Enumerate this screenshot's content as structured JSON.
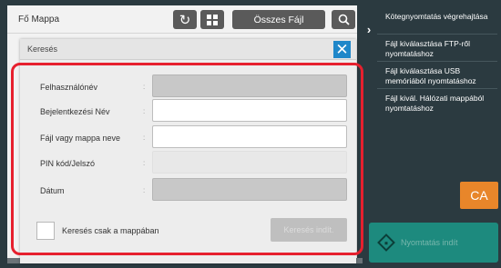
{
  "main": {
    "title": "Fő Mappa",
    "refresh_icon": "refresh-icon",
    "grid_icon": "grid-view-icon",
    "all_files_label": "Összes Fájl",
    "search_icon": "search-icon"
  },
  "right_menu": {
    "arrow": "›",
    "items": [
      {
        "label": "Kötegnyomtatás végrehajtása"
      },
      {
        "label": "Fájl kiválasztása FTP-ről nyomtatáshoz"
      },
      {
        "label": "Fájl kiválasztása USB memóriából nyomtatáshoz"
      },
      {
        "label": "Fájl kivál. Hálózati mappából nyomtatáshoz"
      }
    ],
    "ca_label": "CA",
    "print_label": "Nyomtatás indít"
  },
  "dialog": {
    "title": "Keresés",
    "close_icon": "close-icon",
    "fields": [
      {
        "label": "Felhasználónév",
        "colon": ":",
        "value": "",
        "state": "disabled"
      },
      {
        "label": "Bejelentkezési Név",
        "colon": ":",
        "value": "",
        "state": "enabled"
      },
      {
        "label": "Fájl vagy mappa neve",
        "colon": ":",
        "value": "",
        "state": "enabled"
      },
      {
        "label": "PIN kód/Jelszó",
        "colon": ":",
        "value": "",
        "state": "flat"
      },
      {
        "label": "Dátum",
        "colon": ":",
        "value": "",
        "state": "disabled"
      }
    ],
    "folder_only_label": "Keresés csak a mappában",
    "folder_only_checked": false,
    "start_label": "Keresés indít."
  },
  "colors": {
    "accent_blue": "#1f87c9",
    "highlight_red": "#e6202e",
    "ca_orange": "#e8862a",
    "print_teal": "#1d8a7e",
    "background_dark": "#2b3a40"
  }
}
